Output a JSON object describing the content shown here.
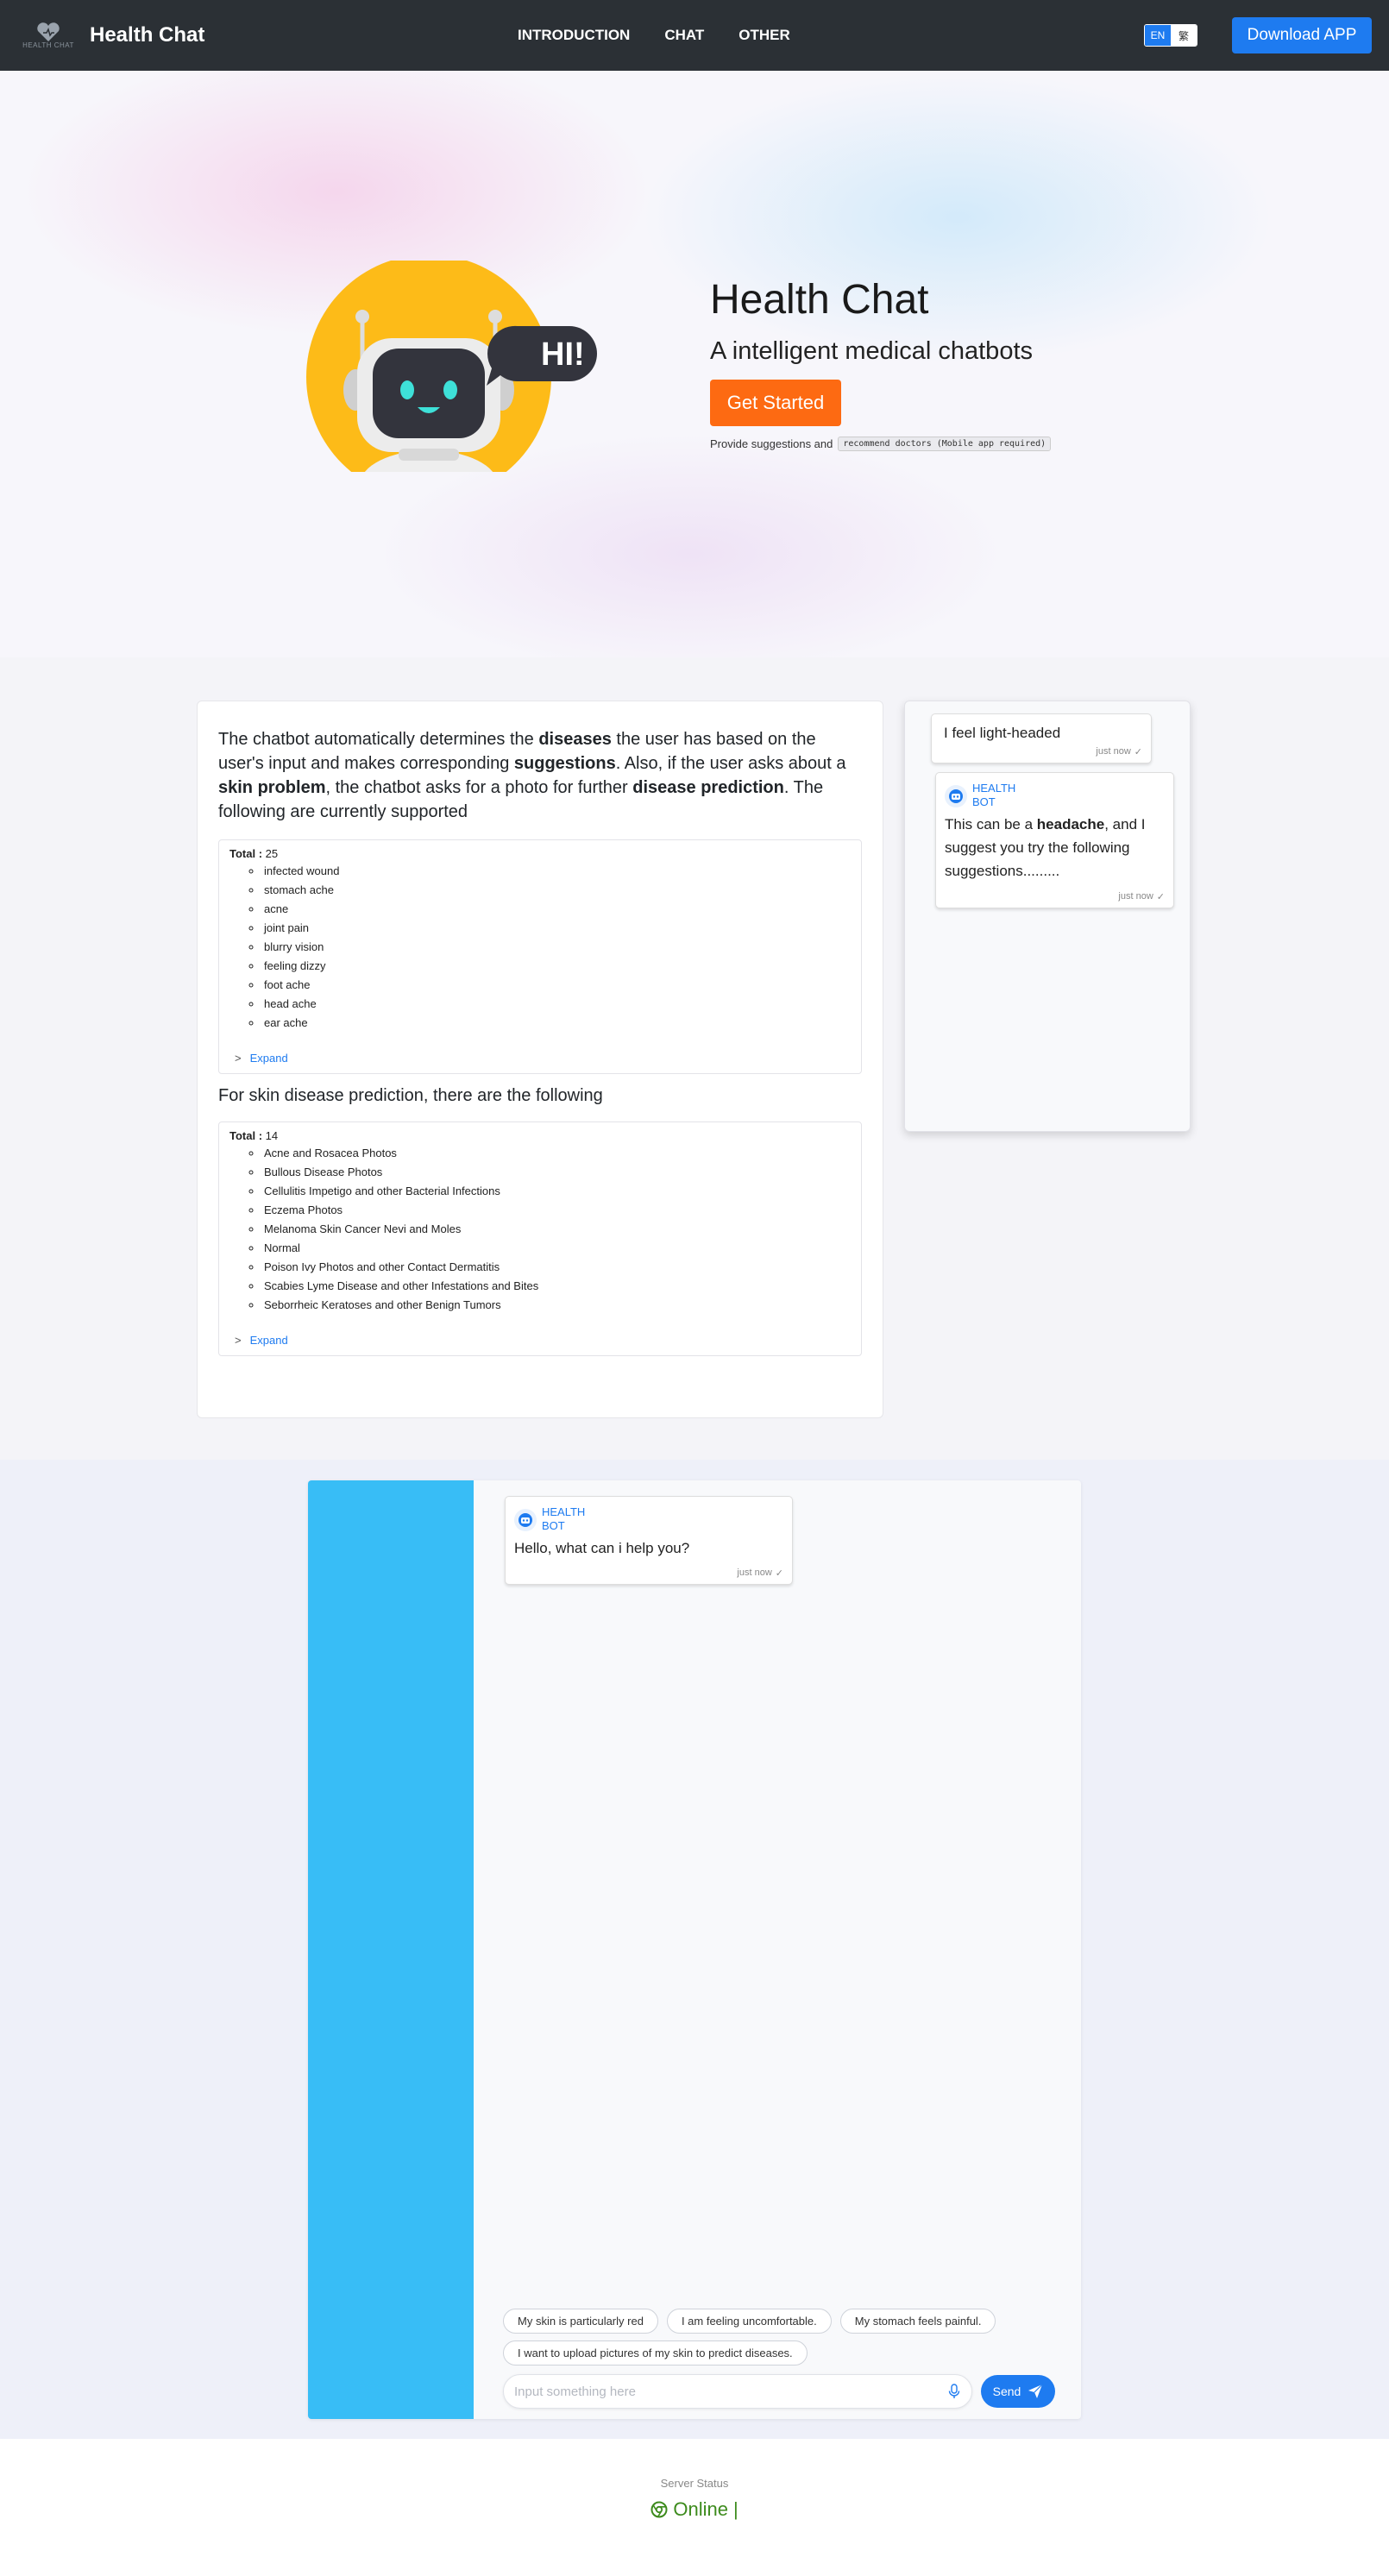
{
  "navbar": {
    "logo_text": "HEALTH CHAT",
    "brand": "Health Chat",
    "links": [
      "INTRODUCTION",
      "CHAT",
      "OTHER"
    ],
    "lang_en": "EN",
    "lang_zh": "繁",
    "download": "Download APP"
  },
  "hero": {
    "robot_speech": "HI!",
    "title": "Health Chat",
    "subtitle": "A intelligent medical chatbots",
    "cta": "Get Started",
    "note_prefix": "Provide suggestions and",
    "note_code": "recommend doctors (Mobile app required)"
  },
  "info": {
    "p1": "The chatbot automatically determines the ",
    "p1_b1": "diseases",
    "p1_2": " the user has based on the user's input and makes corresponding ",
    "p1_b2": "suggestions",
    "p1_3": ". Also, if the user asks about a ",
    "p1_b3": "skin problem",
    "p1_4": ", the chatbot asks for a photo for further ",
    "p1_b4": "disease prediction",
    "p1_5": ". The following are currently supported",
    "total_label": "Total :",
    "diseases_total": "25",
    "diseases": [
      "infected wound",
      "stomach ache",
      "acne",
      "joint pain",
      "blurry vision",
      "feeling dizzy",
      "foot ache",
      "head ache",
      "ear ache"
    ],
    "expand": "Expand",
    "skin_intro": "For skin disease prediction, there are the following",
    "skin_total": "14",
    "skin": [
      "Acne and Rosacea Photos",
      "Bullous Disease Photos",
      "Cellulitis Impetigo and other Bacterial Infections",
      "Eczema Photos",
      "Melanoma Skin Cancer Nevi and Moles",
      "Normal",
      "Poison Ivy Photos and other Contact Dermatitis",
      "Scabies Lyme Disease and other Infestations and Bites",
      "Seborrheic Keratoses and other Benign Tumors"
    ]
  },
  "demo": {
    "user_msg": "I feel light-headed",
    "time": "just now",
    "check": "✓",
    "bot_name_1": "HEALTH",
    "bot_name_2": "BOT",
    "bot_msg_1": "This can be a ",
    "bot_msg_b": "headache",
    "bot_msg_2": ", and I suggest you try the following suggestions.........",
    "bot_time": "just now"
  },
  "chat": {
    "bot_name_1": "HEALTH",
    "bot_name_2": "BOT",
    "greeting": "Hello, what can i help you?",
    "time": "just now",
    "suggestions": [
      "My skin is particularly red",
      "I am feeling uncomfortable.",
      "My stomach feels painful.",
      "I want to upload pictures of my skin to predict diseases."
    ],
    "placeholder": "Input something here",
    "send": "Send"
  },
  "footer": {
    "status_label": "Server Status",
    "status": "Online",
    "cursor": "|"
  },
  "colors": {
    "primary": "#1e7bf0",
    "cta": "#fd6a12",
    "sidebar": "#38bdf6",
    "online": "#3d8b1d",
    "navbar": "#2b3035"
  }
}
